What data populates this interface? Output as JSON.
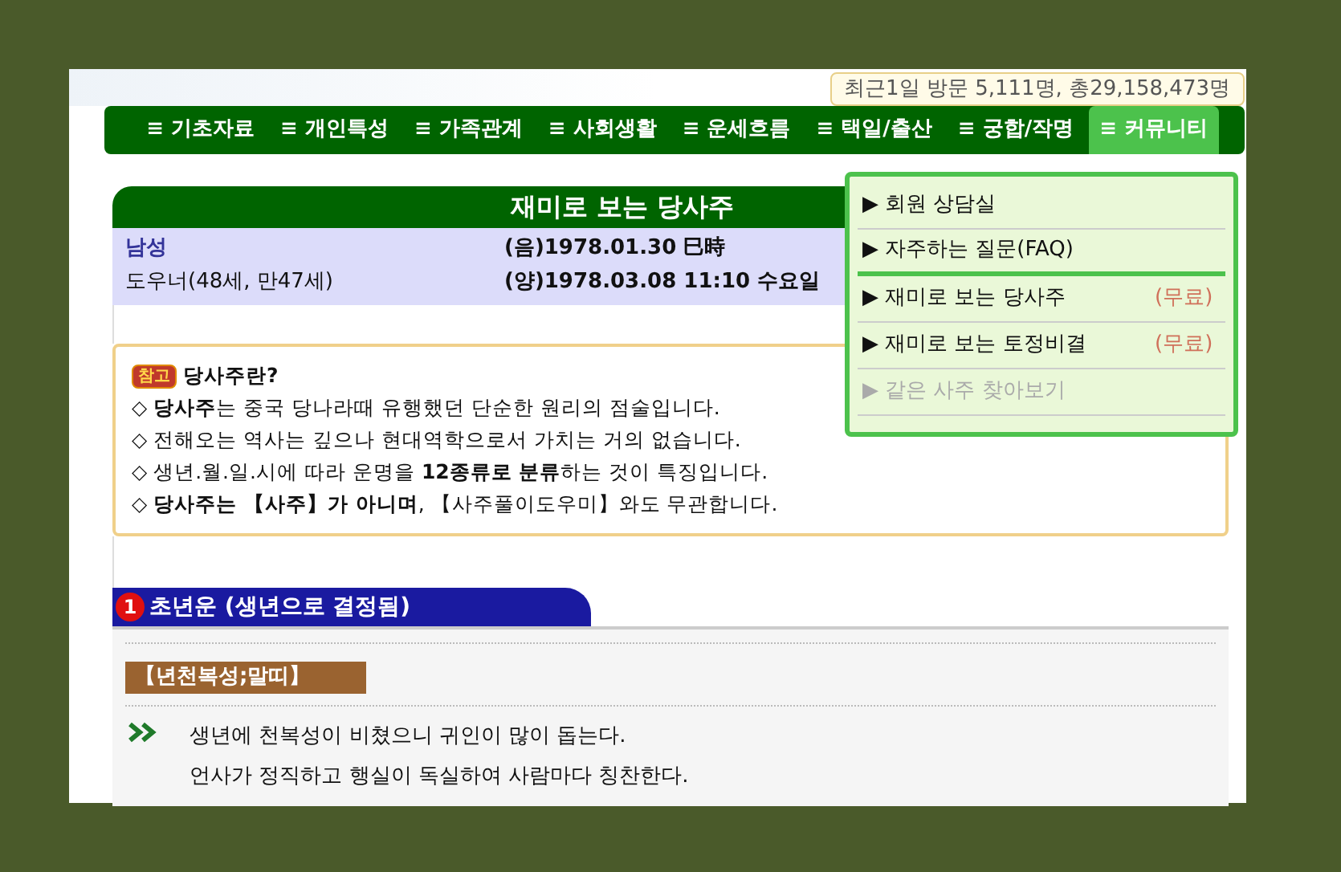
{
  "visitor_counter": "최근1일 방문 5,111명, 총29,158,473명",
  "nav": [
    {
      "label": "≡ 기초자료",
      "selected": false
    },
    {
      "label": "≡ 개인특성",
      "selected": false
    },
    {
      "label": "≡ 가족관계",
      "selected": false
    },
    {
      "label": "≡ 사회생활",
      "selected": false
    },
    {
      "label": "≡ 운세흐름",
      "selected": false
    },
    {
      "label": "≡ 택일/출산",
      "selected": false
    },
    {
      "label": "≡ 궁합/작명",
      "selected": false
    },
    {
      "label": "≡ 커뮤니티",
      "selected": true
    }
  ],
  "menu": [
    {
      "arrow": "▶",
      "label": "회원 상담실",
      "disabled": false,
      "divider_after": false
    },
    {
      "arrow": "▶",
      "label": "자주하는 질문(FAQ)",
      "disabled": false,
      "divider_after": true
    },
    {
      "arrow": "▶",
      "label": "재미로 보는 당사주",
      "badge": "(무료)",
      "disabled": false,
      "divider_after": false
    },
    {
      "arrow": "▶",
      "label": "재미로 보는 토정비결",
      "badge": "(무료)",
      "disabled": false,
      "divider_after": false
    },
    {
      "arrow": "▶",
      "label": "같은 사주 찾아보기",
      "disabled": true,
      "divider_after": false
    }
  ],
  "title": "재미로 보는 당사주",
  "person": {
    "gender": "남성",
    "name": "도우너(48세, 만47세)",
    "lunar": "(음)1978.01.30 巳時",
    "solar": "(양)1978.03.08 11:10 수요일"
  },
  "note": {
    "tag": "참고",
    "heading": "당사주란?",
    "lines": [
      "◇ **당사주**는 중국 당나라때 유행했던 단순한 원리의 점술입니다.",
      "◇ 전해오는 역사는 깊으나 현대역학으로서 가치는 거의 없습니다.",
      "◇ 생년.월.일.시에 따라 운명을 **12종류로 분류**하는 것이 특징입니다.",
      "◇ **당사주는 【사주】가 아니며**, 【사주풀이도우미】와도 무관합니다."
    ]
  },
  "section": {
    "number": "1",
    "title": "초년운 (생년으로 결정됨)",
    "label": "【년천복성;말띠】",
    "lines": [
      "생년에 천복성이 비쳤으니 귀인이 많이 돕는다.",
      "언사가 정직하고 행실이 독실하여 사람마다 칭찬한다."
    ]
  }
}
